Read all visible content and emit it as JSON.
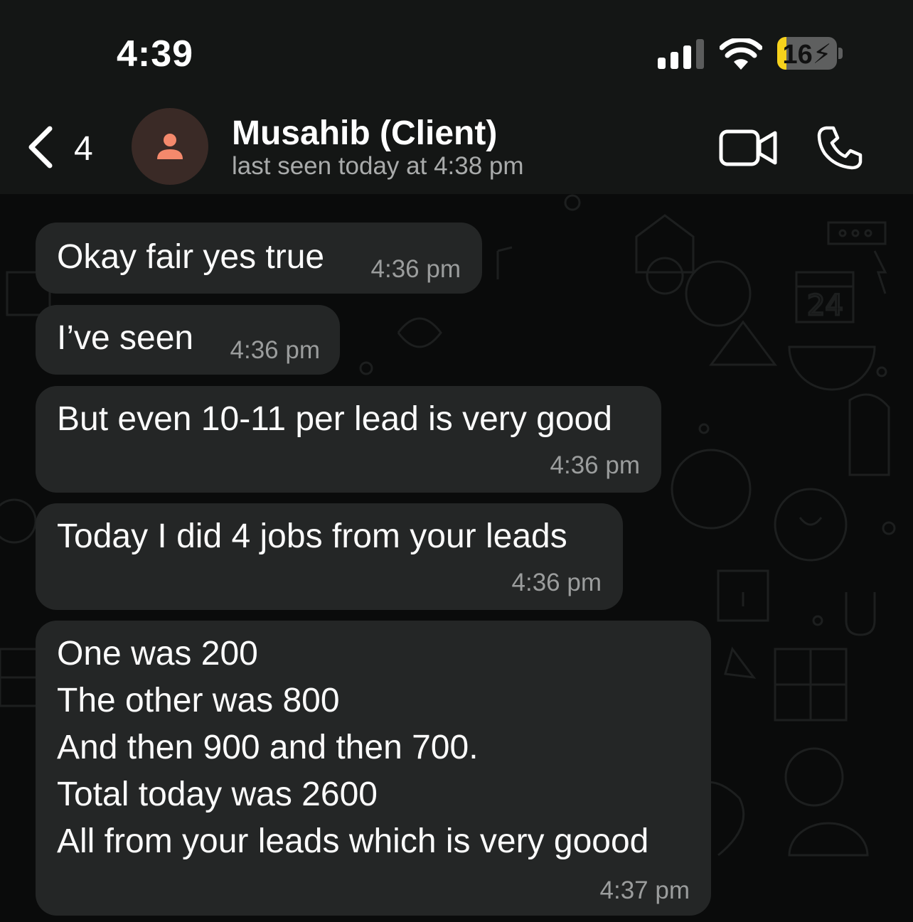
{
  "status_bar": {
    "time": "4:39",
    "battery": "16",
    "battery_level_percent": 16
  },
  "nav": {
    "back_count": "4"
  },
  "contact": {
    "name": "Musahib (Client)",
    "status": "last seen today at 4:38 pm"
  },
  "messages": [
    {
      "text": "Okay fair yes true",
      "time": "4:36 pm"
    },
    {
      "text": "I’ve seen",
      "time": "4:36 pm"
    },
    {
      "text": "But even 10-11 per lead is very good",
      "time": "4:36 pm"
    },
    {
      "text": "Today I did 4 jobs from your leads",
      "time": "4:36 pm"
    },
    {
      "lines": [
        "One was 200",
        "The other was 800",
        "And then 900 and then 700.",
        "Total today was 2600",
        "All from your leads which is very goood"
      ],
      "time": "4:37 pm"
    }
  ],
  "colors": {
    "header_bg": "#141615",
    "chat_bg": "#0a0b0b",
    "bubble_bg": "#242626",
    "battery_fill": "#f7d21c",
    "avatar_icon": "#f4896c"
  }
}
